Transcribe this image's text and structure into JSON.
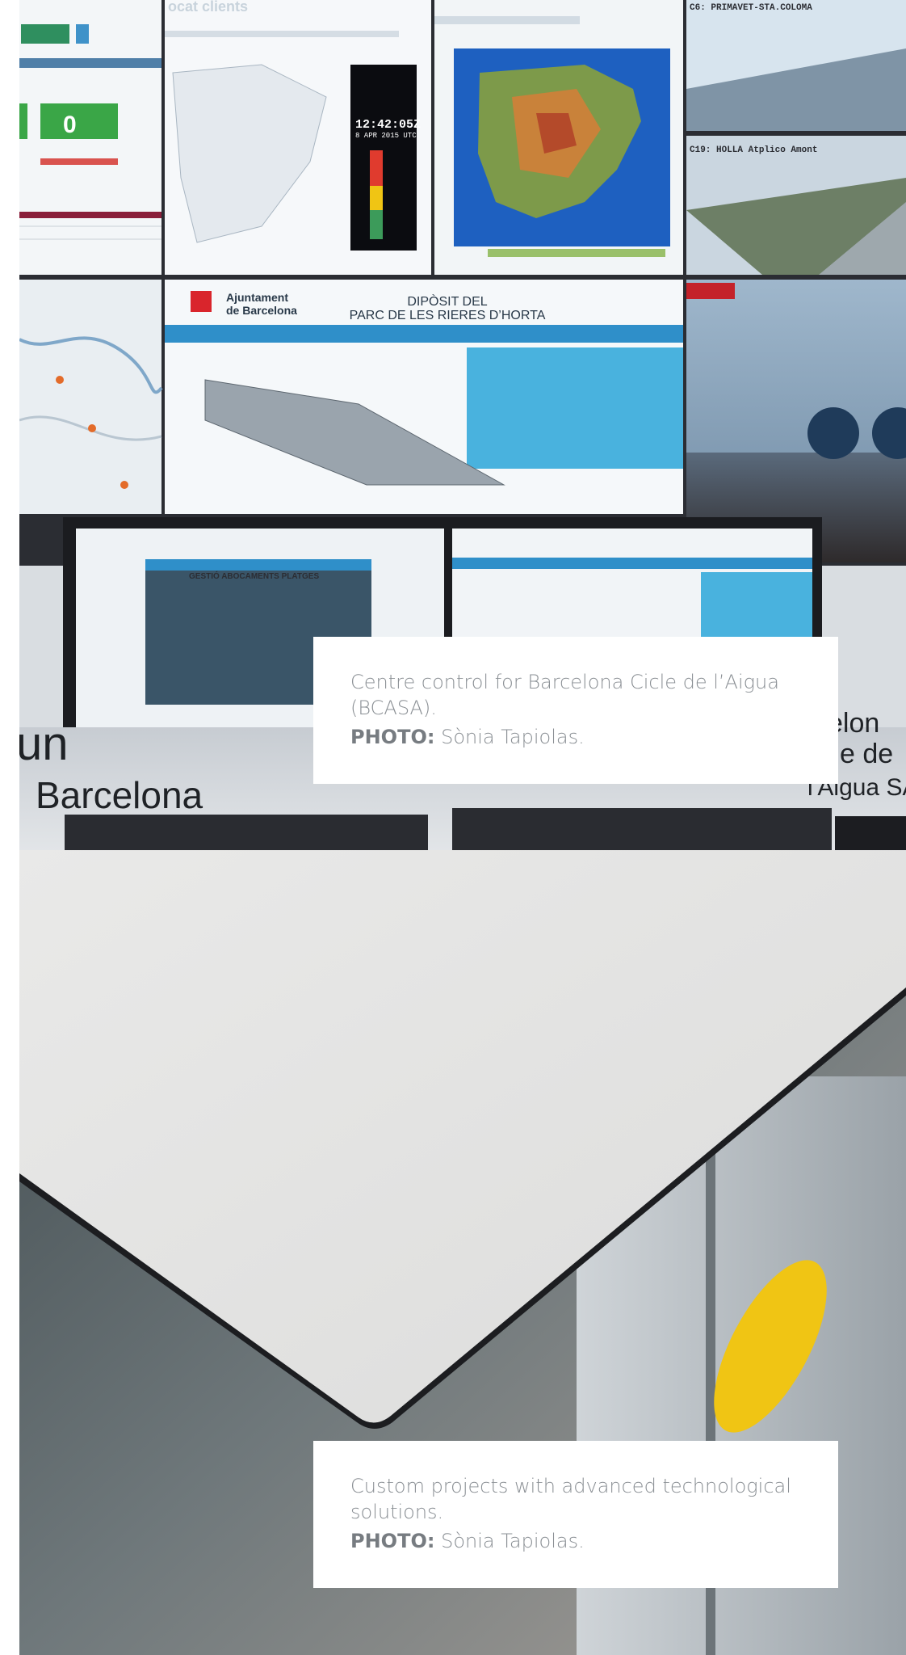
{
  "photos": [
    {
      "subject": "control-room-video-wall",
      "caption": "Centre control for Barcelona Cicle de l’Aigua (BCASA).",
      "credit_label": "PHOTO:",
      "credit_name": "Sònia Tapiolas.",
      "screens": {
        "wall_top_left_title": "ocat clients",
        "dashboard_value": "0",
        "weather_time": "12:42:05Z",
        "weather_date": "8 APR 2015 UTC",
        "camera_1": "C6: PRIMAVET-STA.COLOMA",
        "camera_2": "C19: HOLLA Atplico Amont",
        "dam_title_line1": "DIPÒSIT DEL",
        "dam_title_line2": "PARC DE LES RIERES D’HORTA",
        "council_line1": "Ajuntament",
        "council_line2": "de Barcelona",
        "monitor_title": "GESTIÓ ABOCAMENTS PLATGES",
        "backdrop_word_left": "un",
        "backdrop_word_bottom": "Barcelona",
        "backdrop_word_right_1": "celon",
        "backdrop_word_right_2": "e de",
        "backdrop_word_right_3": "l'Aigua SA"
      },
      "colors": {
        "screen_glow": "#e9f2f8",
        "dashboard_green": "#3aa647",
        "ui_blue": "#2f8fc9"
      }
    },
    {
      "subject": "white-table-corner",
      "caption": "Custom projects with advanced technological solutions.",
      "credit_label": "PHOTO:",
      "credit_name": "Sònia Tapiolas.",
      "colors": {
        "table_top": "#e4e4e3",
        "floor": "#5f6a6e",
        "sticker": "#f0c514"
      }
    }
  ]
}
